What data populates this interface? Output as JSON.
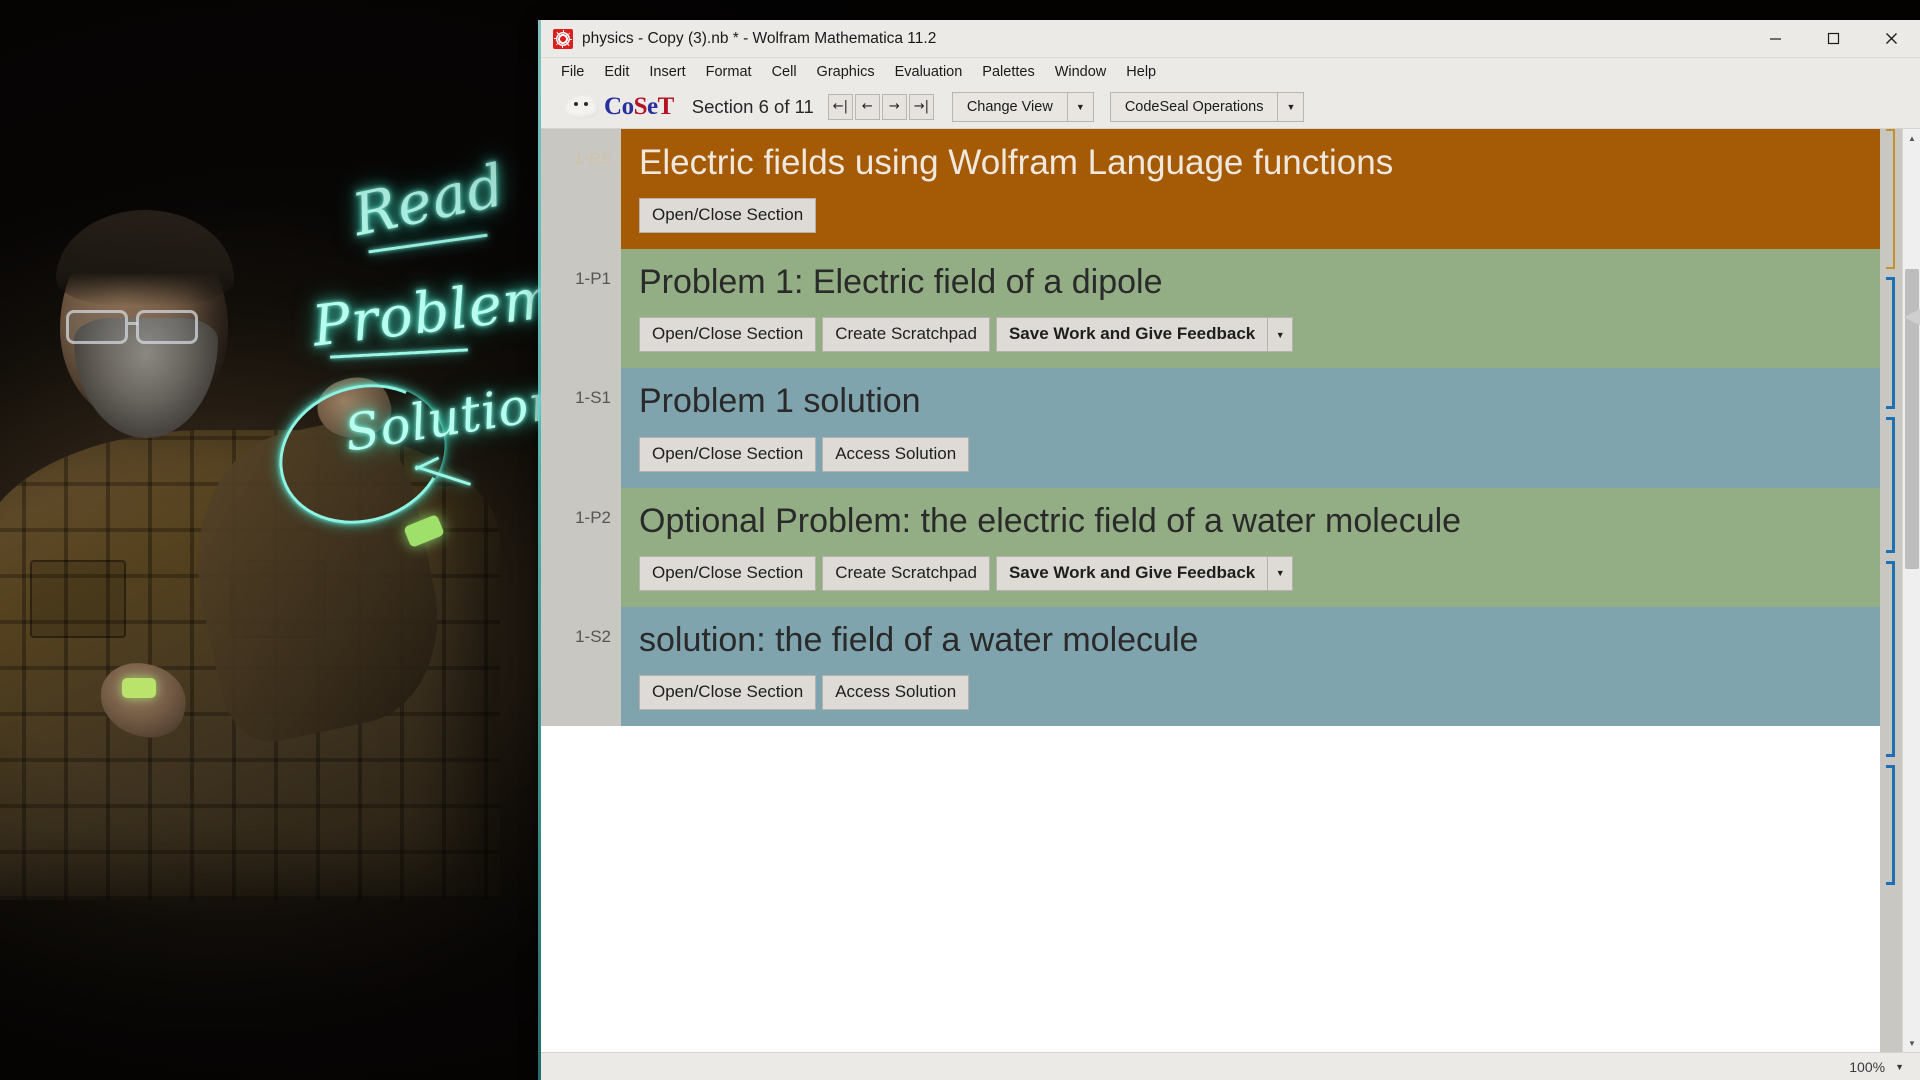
{
  "window": {
    "title": "physics - Copy (3).nb * - Wolfram Mathematica 11.2",
    "icon": "wolfram-spikey-icon",
    "controls": {
      "minimize": "minimize-icon",
      "maximize": "maximize-icon",
      "close": "close-icon"
    }
  },
  "menu": {
    "items": [
      {
        "label": "File"
      },
      {
        "label": "Edit"
      },
      {
        "label": "Insert"
      },
      {
        "label": "Format"
      },
      {
        "label": "Cell"
      },
      {
        "label": "Graphics"
      },
      {
        "label": "Evaluation"
      },
      {
        "label": "Palettes"
      },
      {
        "label": "Window"
      },
      {
        "label": "Help"
      }
    ]
  },
  "toolbar": {
    "logo_text_parts": [
      "C",
      "o",
      "S",
      "e",
      "T"
    ],
    "logo_full": "CoSeT",
    "section_label": "Section 6 of 11",
    "nav_buttons": [
      {
        "name": "first",
        "glyph": "←|"
      },
      {
        "name": "previous",
        "glyph": "←"
      },
      {
        "name": "next",
        "glyph": "→"
      },
      {
        "name": "last",
        "glyph": "→|"
      }
    ],
    "change_view_label": "Change View",
    "codeseal_label": "CodeSeal Operations",
    "caret_glyph": "▼"
  },
  "notebook": {
    "cells": [
      {
        "tag": "1-R5",
        "kind": "section",
        "title": "Electric fields using Wolfram Language functions",
        "buttons": [
          {
            "label": "Open/Close Section",
            "type": "plain"
          }
        ]
      },
      {
        "tag": "1-P1",
        "kind": "problem",
        "title": "Problem 1: Electric field of a dipole",
        "buttons": [
          {
            "label": "Open/Close Section",
            "type": "plain"
          },
          {
            "label": "Create Scratchpad",
            "type": "plain"
          },
          {
            "label": "Save Work and Give Feedback",
            "type": "split"
          }
        ]
      },
      {
        "tag": "1-S1",
        "kind": "solution",
        "title": "Problem 1 solution",
        "buttons": [
          {
            "label": "Open/Close Section",
            "type": "plain"
          },
          {
            "label": "Access Solution",
            "type": "plain"
          }
        ]
      },
      {
        "tag": "1-P2",
        "kind": "problem",
        "title": "Optional Problem: the electric field of a water molecule",
        "buttons": [
          {
            "label": "Open/Close Section",
            "type": "plain"
          },
          {
            "label": "Create Scratchpad",
            "type": "plain"
          },
          {
            "label": "Save Work and Give Feedback",
            "type": "split"
          }
        ]
      },
      {
        "tag": "1-S2",
        "kind": "solution",
        "title": "solution: the field of a water molecule",
        "buttons": [
          {
            "label": "Open/Close Section",
            "type": "plain"
          },
          {
            "label": "Access Solution",
            "type": "plain"
          }
        ]
      }
    ]
  },
  "status": {
    "zoom": "100%",
    "zoom_caret": "▼"
  },
  "video": {
    "handwriting": {
      "read": "Read",
      "problem": "Problem",
      "solution": "Solution"
    }
  },
  "colors": {
    "section_cell": "#a55a05",
    "problem_cell": "#93ae85",
    "solution_cell": "#7fa4ad",
    "chrome": "#eceae7",
    "gutter": "#c8c7c2",
    "logo_blue": "#2a2f9e",
    "logo_red": "#b31424",
    "glow": "#46e3c8"
  }
}
